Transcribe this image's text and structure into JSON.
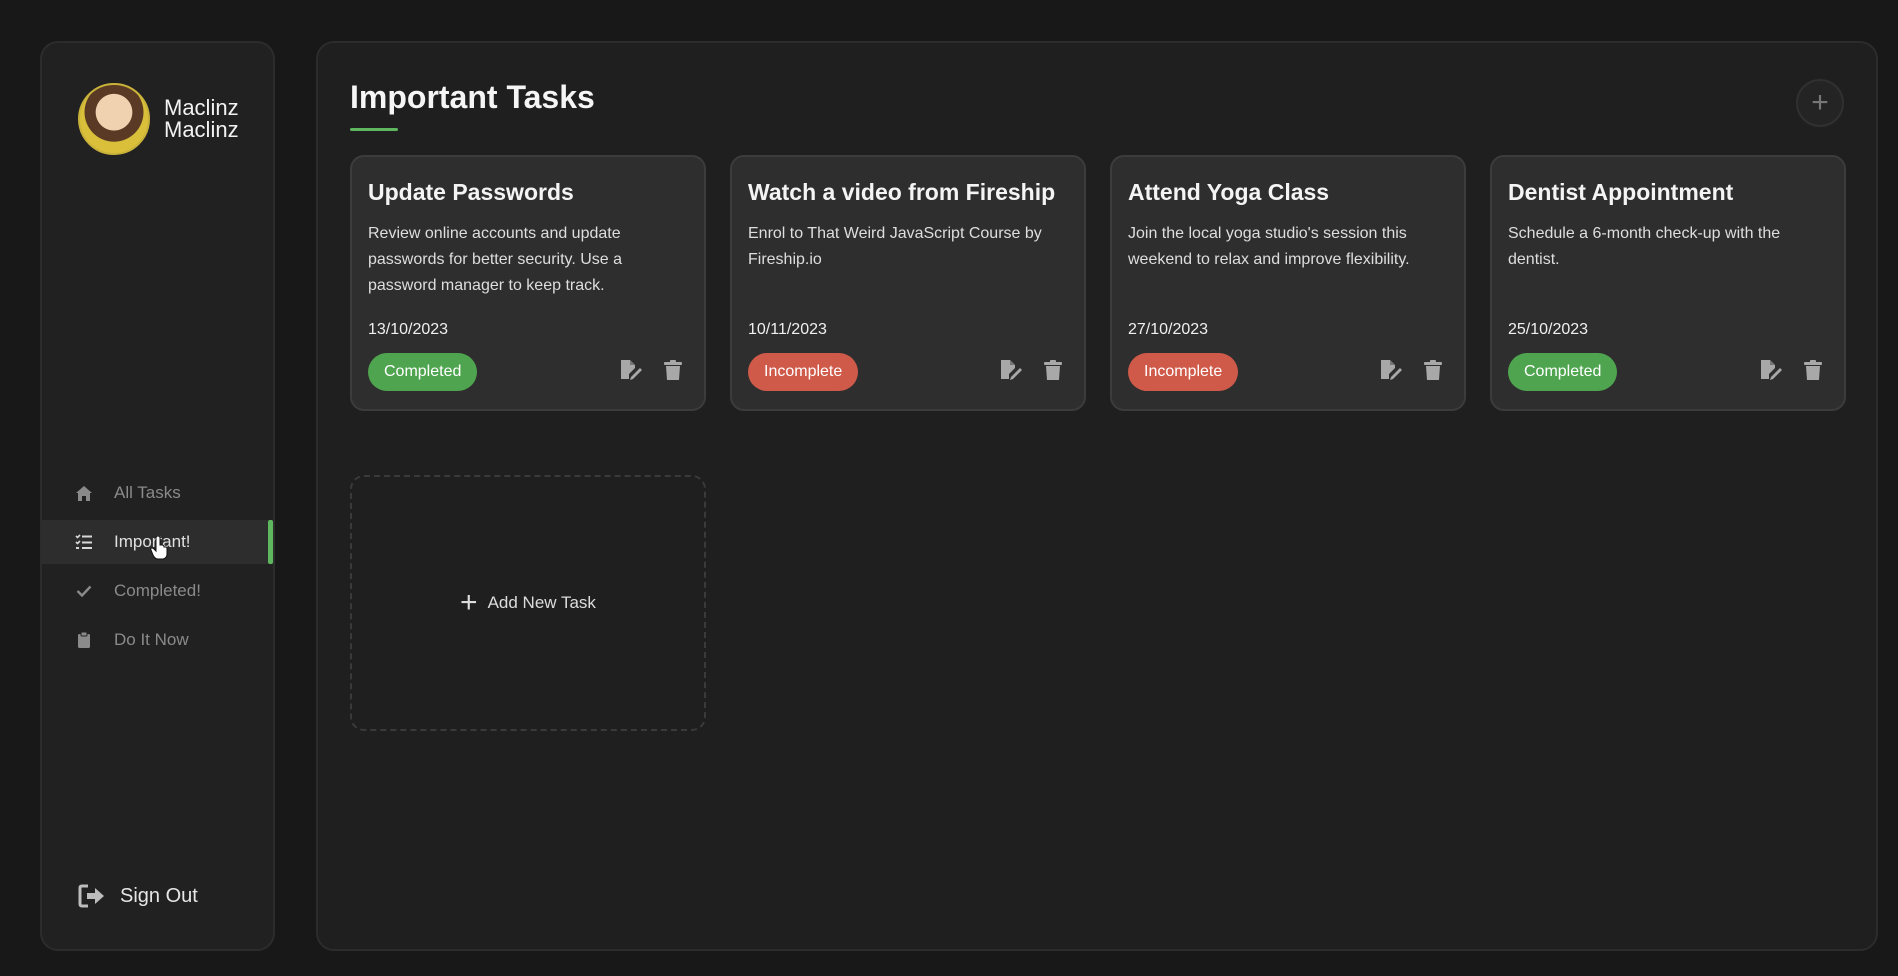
{
  "user": {
    "first_name": "Maclinz",
    "last_name": "Maclinz"
  },
  "sidebar": {
    "items": [
      {
        "label": "All Tasks",
        "icon": "home-icon",
        "active": false
      },
      {
        "label": "Important!",
        "icon": "list-check-icon",
        "active": true
      },
      {
        "label": "Completed!",
        "icon": "check-icon",
        "active": false
      },
      {
        "label": "Do It Now",
        "icon": "clipboard-icon",
        "active": false
      }
    ],
    "sign_out_label": "Sign Out"
  },
  "main": {
    "title": "Important Tasks",
    "add_new_label": "Add New Task"
  },
  "tasks": [
    {
      "title": "Update Passwords",
      "description": "Review online accounts and update passwords for better security. Use a password manager to keep track.",
      "date": "13/10/2023",
      "status": "Completed"
    },
    {
      "title": "Watch a video from Fireship",
      "description": "Enrol to That Weird JavaScript Course by Fireship.io",
      "date": "10/11/2023",
      "status": "Incomplete"
    },
    {
      "title": "Attend Yoga Class",
      "description": "Join the local yoga studio's session this weekend to relax and improve flexibility.",
      "date": "27/10/2023",
      "status": "Incomplete"
    },
    {
      "title": "Dentist Appointment",
      "description": "Schedule a 6-month check-up with the dentist.",
      "date": "25/10/2023",
      "status": "Completed"
    }
  ],
  "colors": {
    "accent": "#5eb65e",
    "completed": "#4fa54f",
    "incomplete": "#cf5a4a",
    "card_bg": "#2e2e2e",
    "panel_bg": "#1f1f1f"
  }
}
